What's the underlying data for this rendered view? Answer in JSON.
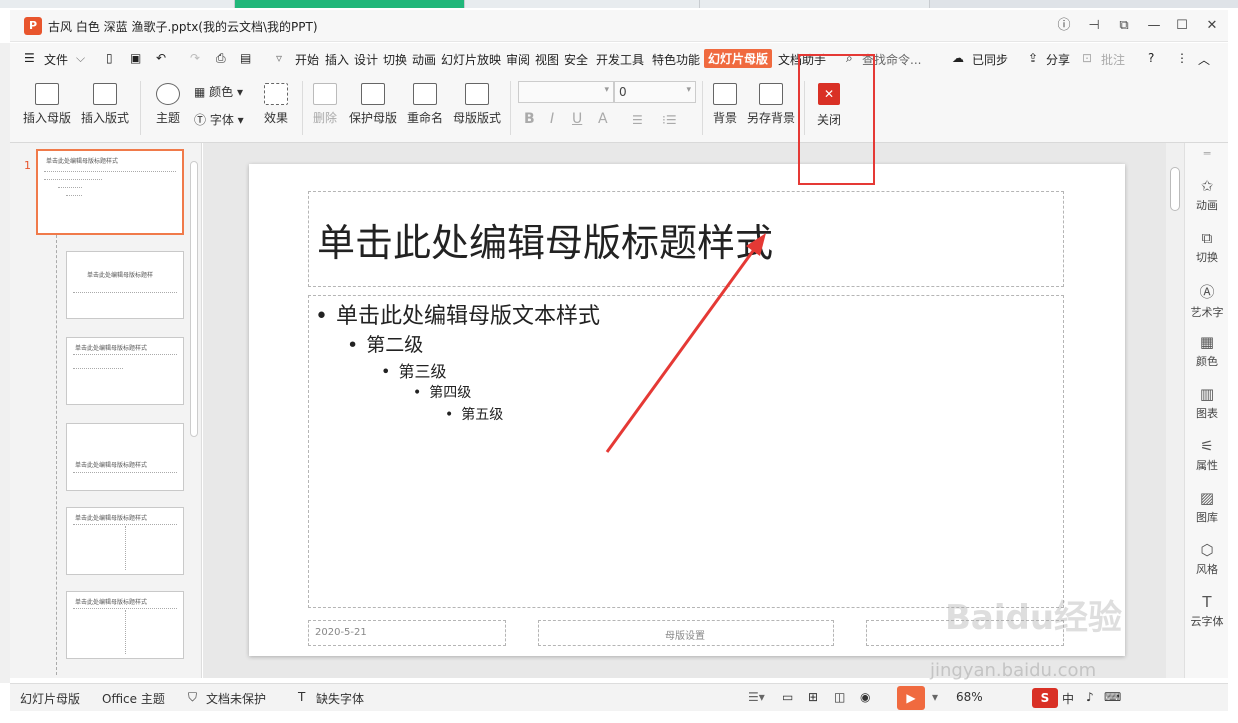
{
  "window": {
    "doc_title": "古风 白色 深蓝 渔歌子.pptx(我的云文档\\我的PPT)",
    "app_icon": "P"
  },
  "menu": {
    "file": "文件",
    "tabs": [
      "开始",
      "插入",
      "设计",
      "切换",
      "动画",
      "幻灯片放映",
      "审阅",
      "视图",
      "安全",
      "开发工具",
      "特色功能",
      "幻灯片母版",
      "文档助手"
    ],
    "active_tab": "幻灯片母版",
    "search_placeholder": "查找命令...",
    "synced": "已同步",
    "share": "分享",
    "comment": "批注"
  },
  "ribbon": {
    "insert_master": "插入母版",
    "insert_layout": "插入版式",
    "theme": "主题",
    "color": "颜色",
    "font": "字体",
    "effect": "效果",
    "delete": "删除",
    "protect_master": "保护母版",
    "rename": "重命名",
    "master_layout": "母版版式",
    "font_size_value": "0",
    "background": "背景",
    "save_background": "另存背景",
    "close": "关闭"
  },
  "thumbnails": {
    "first_index": "1",
    "title_text": "单击此处编辑母版标题样式",
    "layout_title": "单击此处编辑母版标题样"
  },
  "slide": {
    "title": "单击此处编辑母版标题样式",
    "levels": [
      "单击此处编辑母版文本样式",
      "第二级",
      "第三级",
      "第四级",
      "第五级"
    ],
    "footer_date": "2020-5-21",
    "footer_center": "母版设置"
  },
  "right_panel": [
    "动画",
    "切换",
    "艺术字",
    "颜色",
    "图表",
    "属性",
    "图库",
    "风格",
    "云字体"
  ],
  "status": {
    "view": "幻灯片母版",
    "theme": "Office 主题",
    "protect": "文档未保护",
    "missing_font": "缺失字体",
    "zoom": "68%"
  },
  "watermark": {
    "brand": "Baidu经验",
    "url": "jingyan.baidu.com"
  },
  "colors": {
    "accent": "#f06a3f",
    "active_tab_bg": "#f06a3f",
    "annotation_red": "#e53935",
    "close_icon_bg": "#d93025"
  }
}
